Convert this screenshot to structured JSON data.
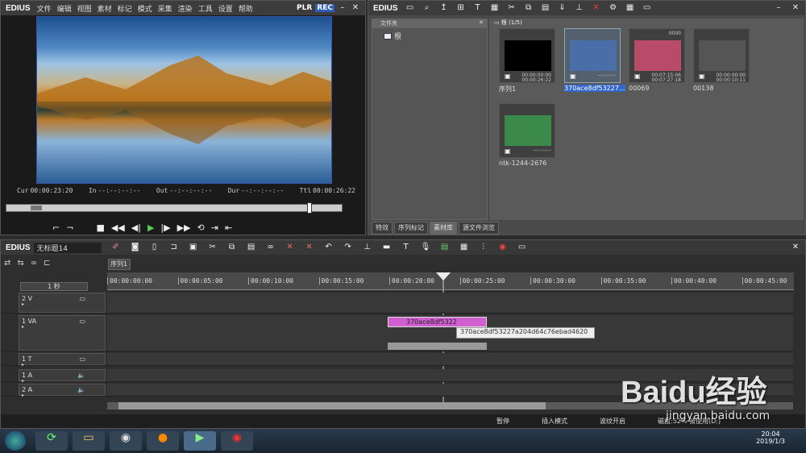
{
  "player": {
    "app": "EDIUS",
    "menu": [
      "文件",
      "编辑",
      "视图",
      "素材",
      "标记",
      "模式",
      "采集",
      "渲染",
      "工具",
      "设置",
      "帮助"
    ],
    "plr": "PLR",
    "rec": "REC",
    "timecodes": [
      {
        "label": "Cur",
        "value": "00:00:23:20"
      },
      {
        "label": "In",
        "value": "--:--:--:--"
      },
      {
        "label": "Out",
        "value": "--:--:--:--"
      },
      {
        "label": "Dur",
        "value": "--:--:--:--"
      },
      {
        "label": "Ttl",
        "value": "00:00:26:22"
      }
    ]
  },
  "bin": {
    "app": "EDIUS",
    "folder_header": "文件夹",
    "root": "根",
    "path": "根 (1/5)",
    "items": [
      {
        "name": "序列1",
        "tc1": "00:00:00:00",
        "tc2": "00:00:26:22",
        "color": "#000"
      },
      {
        "name": "370ace8df53227...",
        "tc1": "--:--:--:--",
        "tc2": "",
        "color": "#4a6fa8"
      },
      {
        "name": "00069",
        "tc1": "00:07:15:06",
        "tc2": "00:07:27:18",
        "color": "#b84a6a",
        "badge": "0000"
      },
      {
        "name": "00138",
        "tc1": "00:00:00:00",
        "tc2": "00:00:10:11",
        "color": "#555"
      },
      {
        "name": "ntk-1244-2676",
        "tc1": "--:--:--:--",
        "tc2": "",
        "color": "#3b8a4a"
      }
    ],
    "tabs": [
      "特效",
      "序列标记",
      "素材库",
      "源文件浏览"
    ]
  },
  "timeline": {
    "app": "EDIUS",
    "project": "无标题14",
    "sequence_tab": "序列1",
    "scale": "1 秒",
    "ruler": [
      "00:00:00:00",
      "00:00:05:00",
      "00:00:10:00",
      "00:00:15:00",
      "00:00:20:00",
      "00:00:25:00",
      "00:00:30:00",
      "00:00:35:00",
      "00:00:40:00",
      "00:00:45:00"
    ],
    "tracks": [
      "2 V",
      "1 VA",
      "1 T",
      "1 A",
      "2 A"
    ],
    "clip": {
      "label": "370ace8df5322",
      "tooltip": "370ace8df53227a204d64c76ebad4620"
    },
    "status": {
      "pause": "暂停",
      "insert": "插入模式",
      "ripple": "波纹开启",
      "disk": "磁盘:52% 被使用(D:)"
    }
  },
  "taskbar": {
    "time": "20:04",
    "date": "2019/1/3"
  },
  "watermark": {
    "text": "Baidu经验",
    "url": "jingyan.baidu.com"
  }
}
